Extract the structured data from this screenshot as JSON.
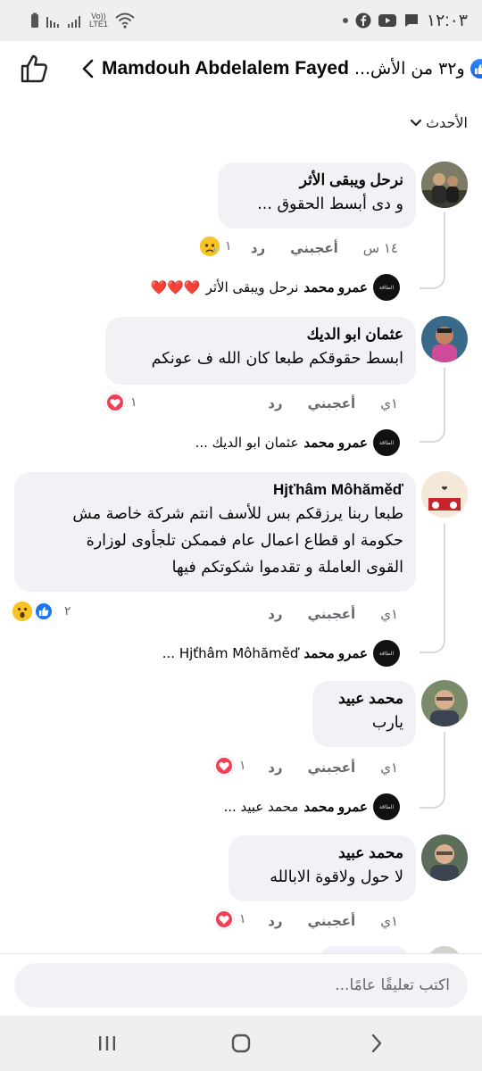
{
  "status_bar": {
    "time": "١٢:٠٣",
    "network_label_top": "Vo))",
    "network_label_bottom": "LTE1"
  },
  "header": {
    "title_name": "Mamdouh Abdelalem Fayed",
    "reaction_text": "و٣٢ من الأش...",
    "accent_color": "#1877f2"
  },
  "sort": {
    "label": "الأحدث"
  },
  "comments": [
    {
      "author": "نرحل ويبقى الأثر",
      "text_lines": [
        "و دى أبسط الحقوق ..."
      ],
      "time": "١٤ س",
      "like_label": "أعجبني",
      "reply_label": "رد",
      "reaction_count": "١",
      "reaction_icons": [
        "sad-icon"
      ],
      "reply_preview": {
        "author": "عمرو محمد",
        "text": "نرحل ويبقى الأثر",
        "emoji": "❤️❤️❤️"
      }
    },
    {
      "author": "عثمان ابو الديك",
      "text_lines": [
        "ابسط حقوقكم طبعا كان الله ف عونكم"
      ],
      "time": "١ي",
      "like_label": "أعجبني",
      "reply_label": "رد",
      "reaction_count": "١",
      "reaction_icons": [
        "love-icon"
      ],
      "reply_preview": {
        "author": "عمرو محمد",
        "text": "عثمان ابو الديك ..."
      }
    },
    {
      "author": "Hjťhâm Môhăměď",
      "text_lines": [
        "طبعا ربنا يرزقكم بس للأسف انتم شركة خاصة مش",
        "حكومة او قطاع اعمال عام فممكن تلجأوى لوزارة",
        "القوى العاملة و تقدموا شكوتكم فيها"
      ],
      "time": "١ي",
      "like_label": "أعجبني",
      "reply_label": "رد",
      "reaction_count": "٢",
      "reaction_icons": [
        "like-icon",
        "wow-icon"
      ],
      "reply_preview": {
        "author": "عمرو محمد",
        "text": "Hjťhâm Môhăměď ..."
      }
    },
    {
      "author": "محمد عبيد",
      "text_lines": [
        "يارب"
      ],
      "time": "١ي",
      "like_label": "أعجبني",
      "reply_label": "رد",
      "reaction_count": "١",
      "reaction_icons": [
        "love-icon"
      ],
      "reply_preview": {
        "author": "عمرو محمد",
        "text": "محمد عبيد ..."
      }
    },
    {
      "author": "محمد عبيد",
      "text_lines": [
        "لا حول ولاقوة الابالله"
      ],
      "time": "١ي",
      "like_label": "أعجبني",
      "reply_label": "رد",
      "reaction_count": "١",
      "reaction_icons": [
        "love-icon"
      ]
    }
  ],
  "reply_avatar_text": "الطاقة",
  "composer": {
    "placeholder": "اكتب تعليقًا عامًا..."
  }
}
